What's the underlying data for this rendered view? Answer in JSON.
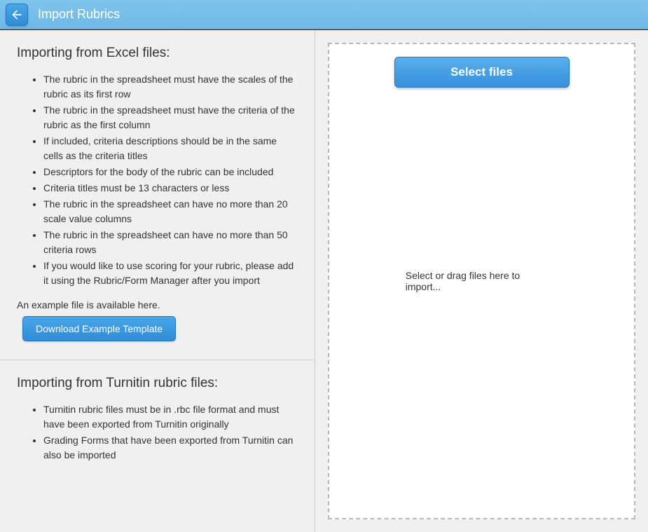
{
  "header": {
    "title": "Import Rubrics"
  },
  "excel_section": {
    "title": "Importing from Excel files:",
    "bullets": [
      "The rubric in the spreadsheet must have the scales of the rubric as its first row",
      "The rubric in the spreadsheet must have the criteria of the rubric as the first column",
      "If included, criteria descriptions should be in the same cells as the criteria titles",
      "Descriptors for the body of the rubric can be included",
      "Criteria titles must be 13 characters or less",
      "The rubric in the spreadsheet can have no more than 20 scale value columns",
      "The rubric in the spreadsheet can have no more than 50 criteria rows",
      "If you would like to use scoring for your rubric, please add it using the Rubric/Form Manager after you import"
    ],
    "example_text": "An example file is available here.",
    "download_button": "Download Example Template"
  },
  "turnitin_section": {
    "title": "Importing from Turnitin rubric files:",
    "bullets": [
      "Turnitin rubric files must be in .rbc file format and must have been exported from Turnitin originally",
      "Grading Forms that have been exported from Turnitin can also be imported"
    ]
  },
  "dropzone": {
    "select_button": "Select files",
    "hint_text": "Select or drag files here to import..."
  }
}
